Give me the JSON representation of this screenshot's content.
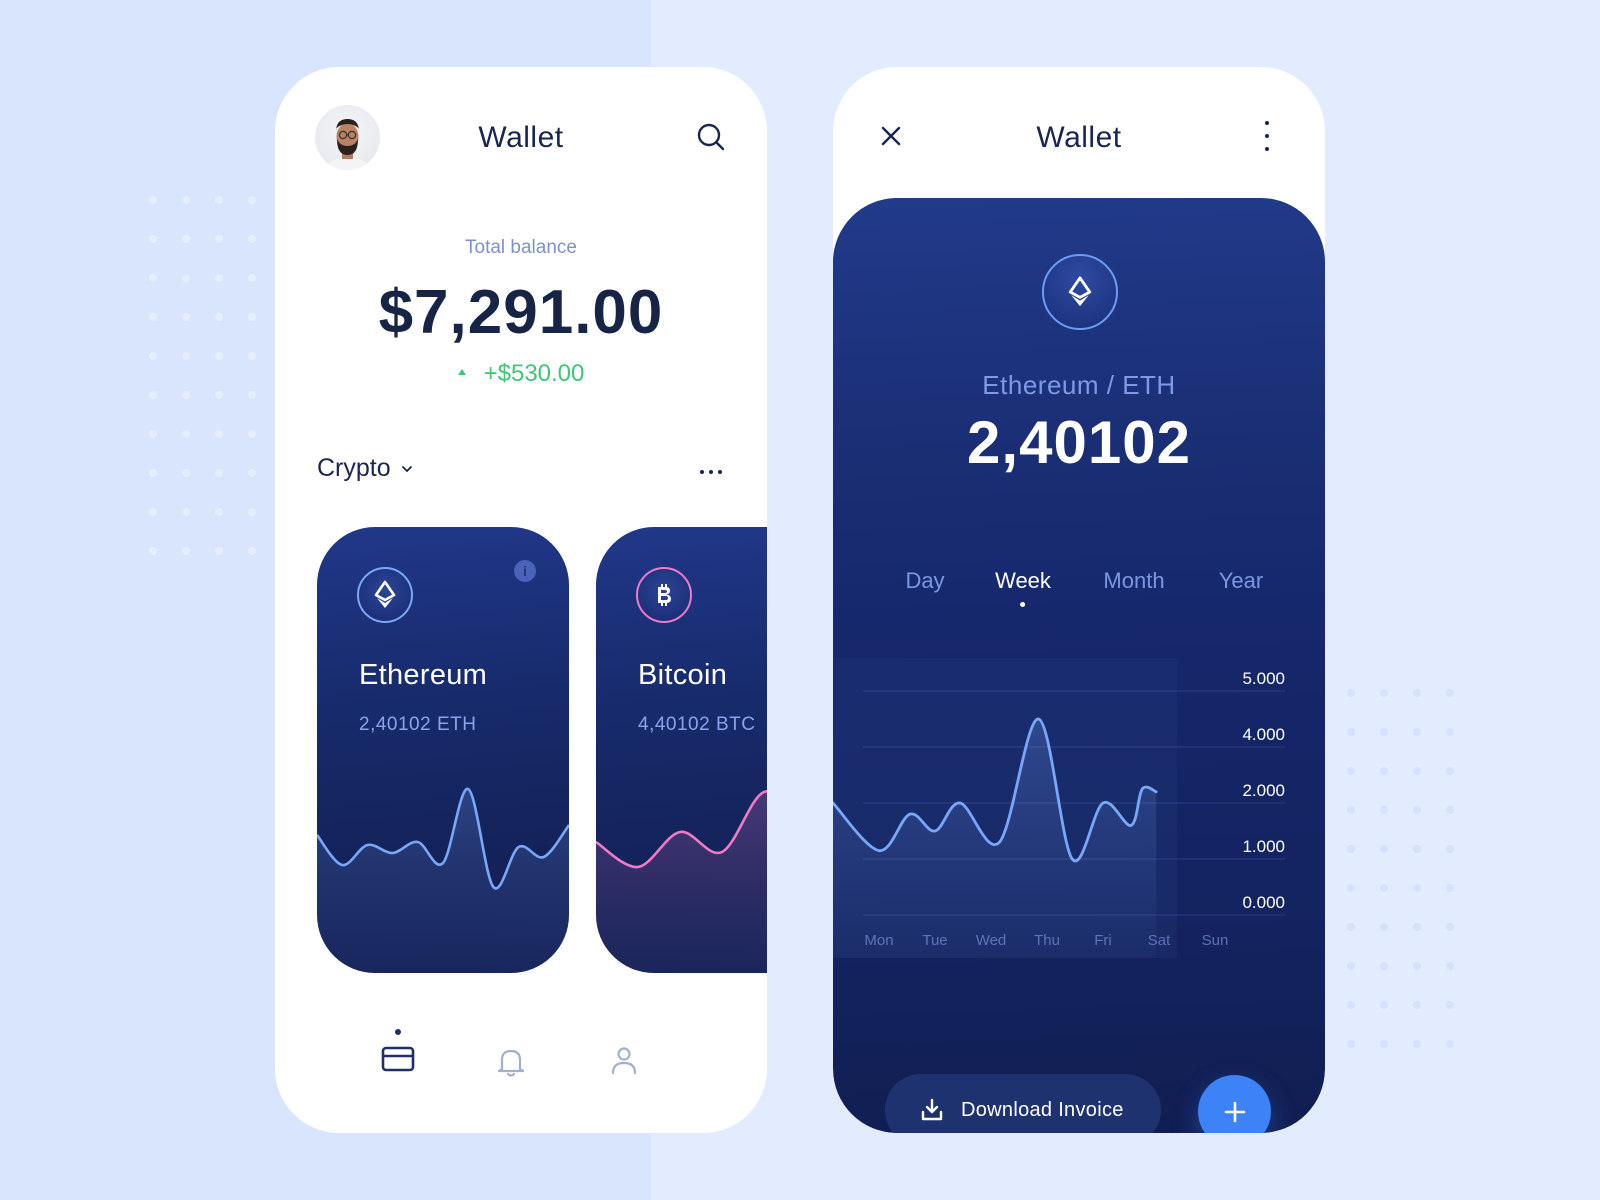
{
  "colors": {
    "navy_text": "#1a2650",
    "muted_blue": "#7f92c7",
    "positive_green": "#3dc774",
    "eth_line": "#7aa7f7",
    "btc_line": "#f07bc6",
    "accent_blue": "#3d82f6"
  },
  "wallet_screen": {
    "title": "Wallet",
    "avatar": "user-avatar",
    "search_icon": "search-icon",
    "total_balance_label": "Total balance",
    "total_balance": "$7,291.00",
    "balance_change": "+$530.00",
    "section_label": "Crypto",
    "coins": [
      {
        "name": "Ethereum",
        "amount": "2,40102 ETH",
        "icon": "ethereum-icon",
        "ring_color": "#7aa7f7",
        "line_color": "#7aa7f7",
        "spark": [
          0.52,
          0.22,
          0.42,
          0.34,
          0.45,
          0.24,
          0.98,
          0.0,
          0.4,
          0.3,
          0.62
        ]
      },
      {
        "name": "Bitcoin",
        "amount": "4,40102 BTC",
        "icon": "bitcoin-icon",
        "ring_color": "#f07bc6",
        "line_color": "#f07bc6",
        "spark": [
          0.45,
          0.2,
          0.55,
          0.35,
          0.95,
          0.7,
          0.78
        ]
      }
    ],
    "nav": [
      {
        "name": "wallet",
        "icon": "card-icon",
        "active": true
      },
      {
        "name": "notifications",
        "icon": "bell-icon",
        "active": false
      },
      {
        "name": "profile",
        "icon": "user-icon",
        "active": false
      }
    ]
  },
  "detail_screen": {
    "title": "Wallet",
    "close_icon": "close-icon",
    "more_icon": "more-vertical-icon",
    "pair_label": "Ethereum / ETH",
    "amount": "2,40102",
    "tabs": [
      "Day",
      "Week",
      "Month",
      "Year"
    ],
    "active_tab": "Week",
    "download_label": "Download Invoice",
    "add_icon": "plus-icon"
  },
  "chart_data": {
    "type": "area",
    "title": "",
    "categories": [
      "Mon",
      "Tue",
      "Wed",
      "Thu",
      "Fri",
      "Sat",
      "Sun"
    ],
    "y_ticks": [
      "5.000",
      "4.000",
      "2.000",
      "1.000",
      "0.000"
    ],
    "y_tick_values": [
      5,
      4,
      2,
      1,
      0
    ],
    "ylim": [
      0,
      5
    ],
    "grid": true,
    "series": [
      {
        "name": "ETH",
        "x": [
          -0.6,
          0.0,
          0.55,
          1.0,
          1.45,
          2.15,
          2.85,
          3.45,
          4.0,
          4.5,
          4.7,
          4.95
        ],
        "values": [
          2.0,
          1.15,
          1.8,
          1.5,
          2.0,
          1.3,
          4.5,
          1.0,
          2.0,
          1.6,
          2.5,
          2.4
        ]
      }
    ],
    "shaded_until": "Sat"
  }
}
